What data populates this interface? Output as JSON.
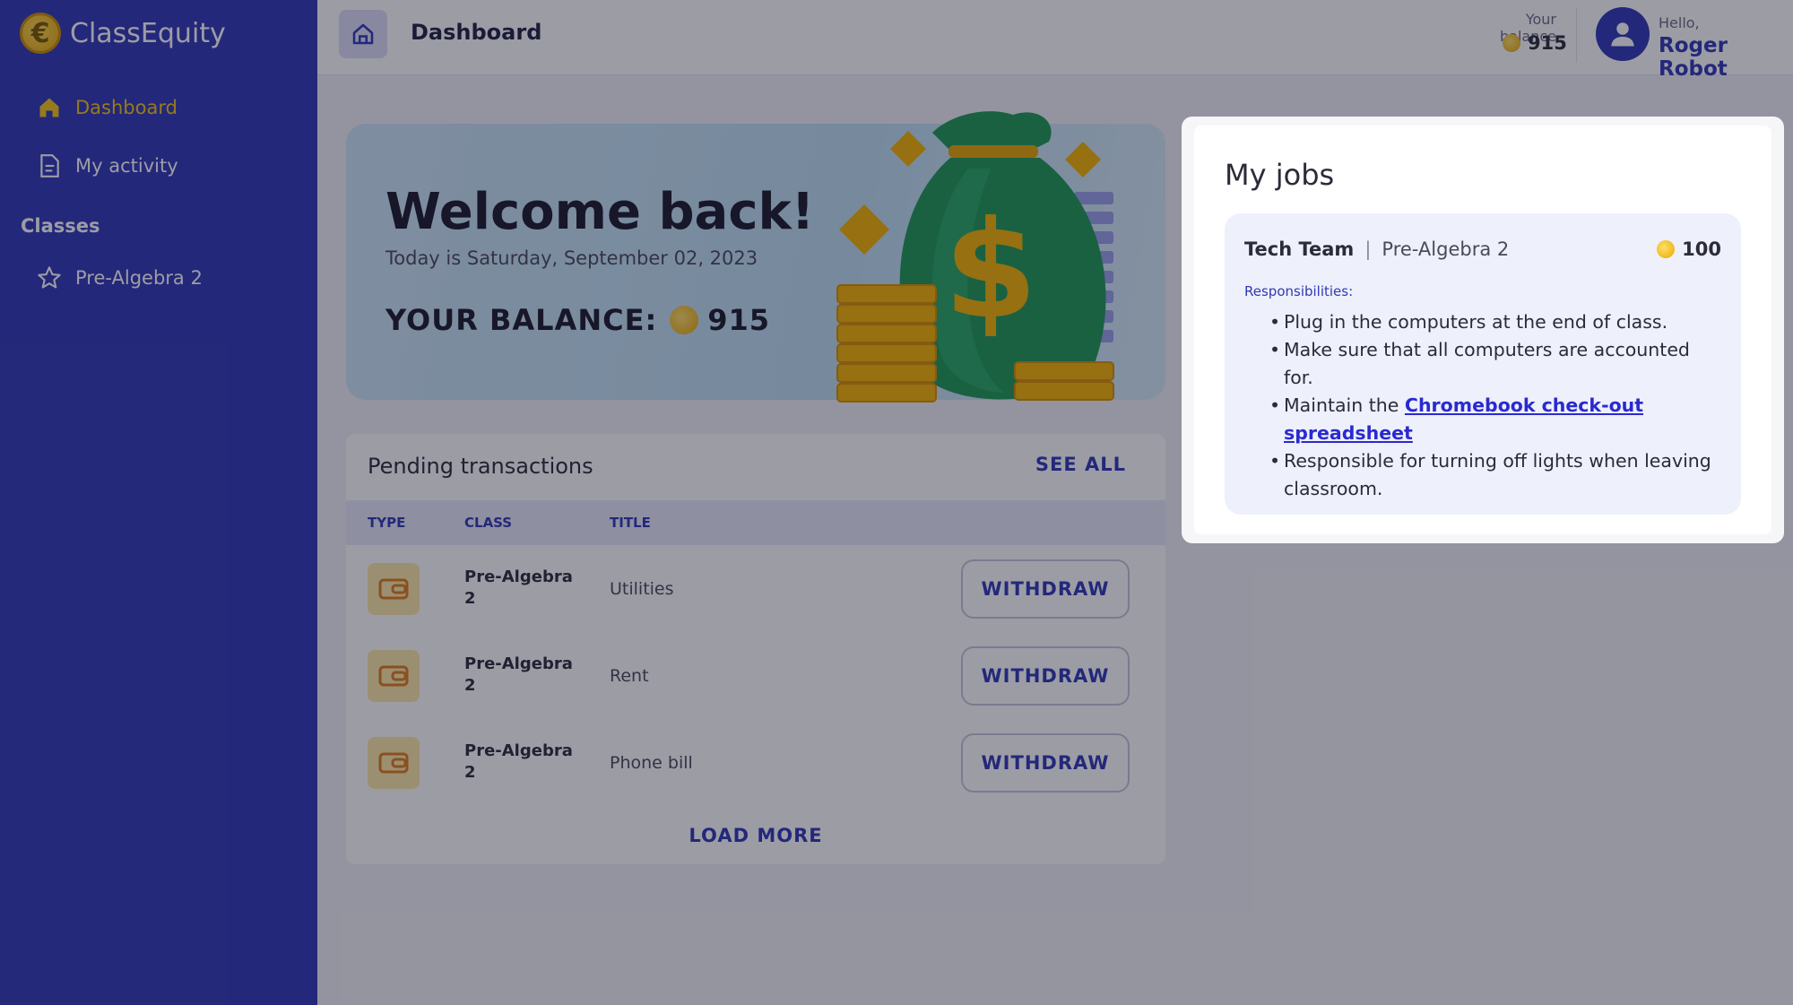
{
  "app": {
    "name": "ClassEquity",
    "logo_letter": "€"
  },
  "sidebar": {
    "items": [
      {
        "label": "Dashboard",
        "icon": "home-icon",
        "active": true
      },
      {
        "label": "My activity",
        "icon": "document-icon",
        "active": false
      }
    ],
    "section_label": "Classes",
    "classes": [
      {
        "label": "Pre-Algebra 2",
        "icon": "star-icon"
      }
    ]
  },
  "header": {
    "title": "Dashboard",
    "balance_label": "Your balance",
    "balance_value": "915",
    "greeting": "Hello,",
    "user_name": "Roger Robot"
  },
  "banner": {
    "heading": "Welcome back!",
    "date_text": "Today is Saturday, September 02, 2023",
    "balance_label": "YOUR BALANCE:",
    "balance_value": "915"
  },
  "pending": {
    "title": "Pending transactions",
    "see_all": "SEE ALL",
    "columns": [
      "TYPE",
      "CLASS",
      "TITLE"
    ],
    "rows": [
      {
        "class": "Pre-Algebra 2",
        "title": "Utilities",
        "action": "WITHDRAW"
      },
      {
        "class": "Pre-Algebra 2",
        "title": "Rent",
        "action": "WITHDRAW"
      },
      {
        "class": "Pre-Algebra 2",
        "title": "Phone bill",
        "action": "WITHDRAW"
      }
    ],
    "load_more": "LOAD MORE"
  },
  "jobs": {
    "title": "My jobs",
    "card": {
      "name": "Tech Team",
      "separator": "|",
      "class": "Pre-Algebra 2",
      "pay": "100",
      "responsibilities_label": "Responsibilities:",
      "responsibilities": [
        "Plug in the computers at the end of class.",
        "Make sure that all computers are accounted for.",
        "Responsible for turning off lights when leaving classroom."
      ],
      "link_prefix": "Maintain the",
      "link_text": "Chromebook check-out spreadsheet"
    }
  },
  "colors": {
    "brand": "#3038b6",
    "accent": "#f5c518",
    "link": "#2a2ad0"
  }
}
